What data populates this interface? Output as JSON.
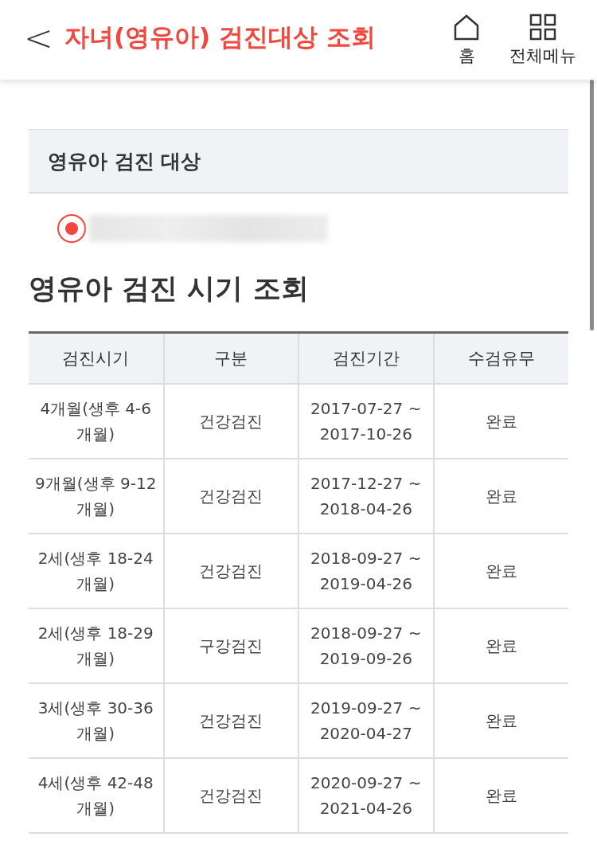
{
  "header": {
    "back": "<",
    "title": "자녀(영유아) 검진대상 조회",
    "actions": [
      {
        "kind": "home",
        "label": "홈"
      },
      {
        "kind": "menu",
        "label": "전체메뉴"
      }
    ]
  },
  "target": {
    "title": "영유아 검진 대상",
    "options": [
      {
        "selected": true
      }
    ]
  },
  "schedule": {
    "title": "영유아 검진 시기 조회",
    "columns": [
      "검진시기",
      "구분",
      "검진기간",
      "수검유무"
    ],
    "rows": [
      [
        "4개월(생후 4-6 개월)",
        "건강검진",
        "2017-07-27 ~ 2017-10-26",
        "완료"
      ],
      [
        "9개월(생후 9-12 개월)",
        "건강검진",
        "2017-12-27 ~ 2018-04-26",
        "완료"
      ],
      [
        "2세(생후 18-24 개월)",
        "건강검진",
        "2018-09-27 ~ 2019-04-26",
        "완료"
      ],
      [
        "2세(생후 18-29 개월)",
        "구강검진",
        "2018-09-27 ~ 2019-09-26",
        "완료"
      ],
      [
        "3세(생후 30-36 개월)",
        "건강검진",
        "2019-09-27 ~ 2020-04-27",
        "완료"
      ],
      [
        "4세(생후 42-48 개월)",
        "건강검진",
        "2020-09-27 ~ 2021-04-26",
        "완료"
      ]
    ]
  }
}
